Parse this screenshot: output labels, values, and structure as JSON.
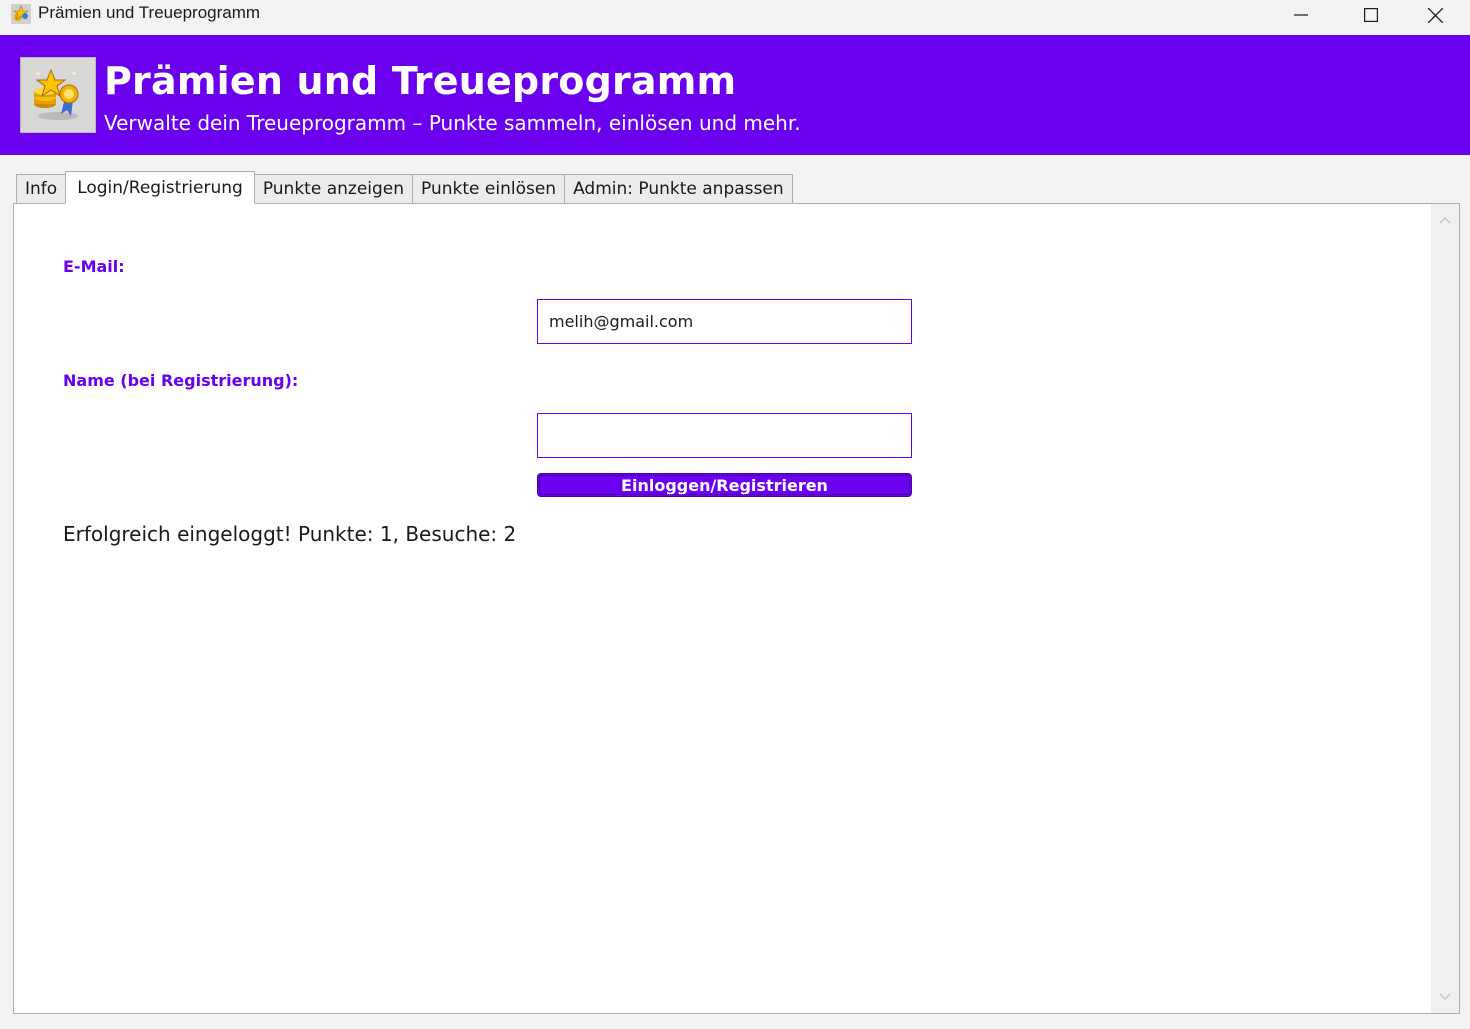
{
  "window": {
    "title": "Prämien und Treueprogramm",
    "controls": [
      "minimize",
      "maximize",
      "close"
    ]
  },
  "header": {
    "title": "Prämien und Treueprogramm",
    "subtitle": "Verwalte dein Treueprogramm – Punkte sammeln, einlösen und mehr.",
    "logo_icon": "reward-medal-icon",
    "accent_color": "#6a00ee"
  },
  "tabs": [
    {
      "label": "Info",
      "active": false
    },
    {
      "label": "Login/Registrierung",
      "active": true
    },
    {
      "label": "Punkte anzeigen",
      "active": false
    },
    {
      "label": "Punkte einlösen",
      "active": false
    },
    {
      "label": "Admin: Punkte anpassen",
      "active": false
    }
  ],
  "form": {
    "email_label": "E-Mail:",
    "email_value": "melih@gmail.com",
    "name_label": "Name (bei Registrierung):",
    "name_value": "",
    "submit_label": "Einloggen/Registrieren"
  },
  "status_message": "Erfolgreich eingeloggt! Punkte: 1, Besuche: 2"
}
